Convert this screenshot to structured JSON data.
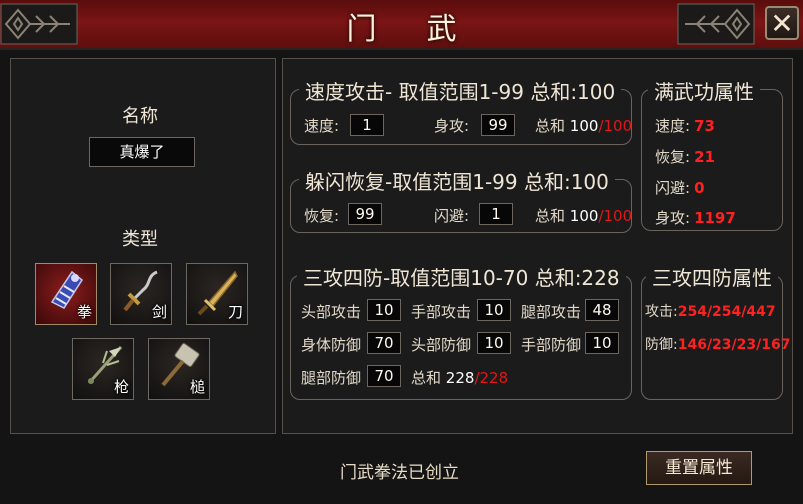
{
  "window": {
    "title": "门武",
    "close_label": "✕"
  },
  "left": {
    "name_label": "名称",
    "name_value": "真爆了",
    "type_label": "类型",
    "weapons": [
      {
        "label": "拳",
        "icon": "fist-gauntlet-icon",
        "selected": true
      },
      {
        "label": "剑",
        "icon": "sword-icon",
        "selected": false
      },
      {
        "label": "刀",
        "icon": "blade-icon",
        "selected": false
      },
      {
        "label": "枪",
        "icon": "spear-icon",
        "selected": false
      },
      {
        "label": "槌",
        "icon": "hammer-icon",
        "selected": false
      }
    ]
  },
  "speed": {
    "title": "速度攻击- 取值范围1-99 总和:100",
    "field1_label": "速度:",
    "field1_value": "1",
    "field2_label": "身攻:",
    "field2_value": "99",
    "sum_label": "总和",
    "sum_current": "100",
    "sum_max": "/100"
  },
  "dodge": {
    "title": "躲闪恢复-取值范围1-99 总和:100",
    "field1_label": "恢复:",
    "field1_value": "99",
    "field2_label": "闪避:",
    "field2_value": "1",
    "sum_label": "总和",
    "sum_current": "100",
    "sum_max": "/100"
  },
  "triple": {
    "title": "三攻四防-取值范围10-70 总和:228",
    "head_atk_label": "头部攻击",
    "head_atk_value": "10",
    "hand_atk_label": "手部攻击",
    "hand_atk_value": "10",
    "leg_atk_label": "腿部攻击",
    "leg_atk_value": "48",
    "body_def_label": "身体防御",
    "body_def_value": "70",
    "head_def_label": "头部防御",
    "head_def_value": "10",
    "hand_def_label": "手部防御",
    "hand_def_value": "10",
    "leg_def_label": "腿部防御",
    "leg_def_value": "70",
    "sum_label": "总和",
    "sum_current": "228",
    "sum_max": "/228"
  },
  "full_attr": {
    "title": "满武功属性",
    "speed_label": "速度:",
    "speed_value": "73",
    "recover_label": "恢复:",
    "recover_value": "21",
    "dodge_label": "闪避:",
    "dodge_value": "0",
    "body_label": "身攻:",
    "body_value": "1197"
  },
  "triple_attr": {
    "title": "三攻四防属性",
    "atk_label": "攻击:",
    "atk_value": "254/254/447",
    "def_label": "防御:",
    "def_value": "146/23/23/167"
  },
  "footer": {
    "status": "门武拳法已创立",
    "reset_label": "重置属性"
  },
  "colors": {
    "accent_red": "#e01818",
    "title_bar": "#7a1515",
    "panel_border": "#6a645d"
  }
}
